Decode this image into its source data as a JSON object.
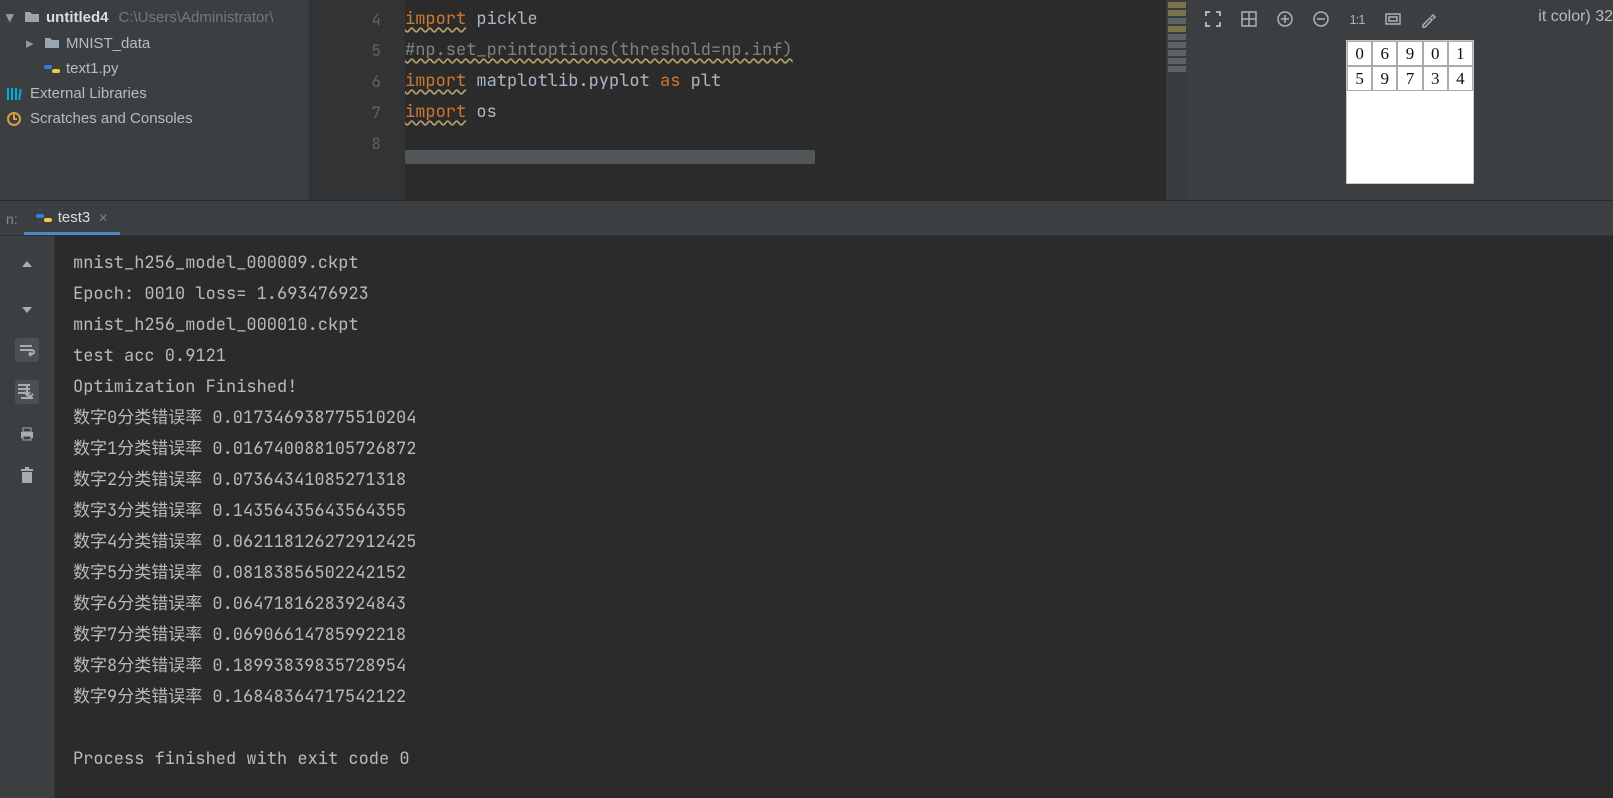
{
  "project_tree": {
    "root": {
      "label": "untitled4",
      "path": "C:\\Users\\Administrator\\"
    },
    "items": [
      {
        "label": "MNIST_data",
        "type": "folder"
      },
      {
        "label": "text1.py",
        "type": "pyfile"
      }
    ],
    "external_label": "External Libraries",
    "scratch_label": "Scratches and Consoles"
  },
  "editor": {
    "gutter_start": 4,
    "lines": [
      {
        "n": 4,
        "html": "<span class='kw wavy-y'>import</span> pickle"
      },
      {
        "n": 5,
        "html": "<span class='comment wavy-y'>#np.set_printoptions(threshold=np.inf)</span>"
      },
      {
        "n": 6,
        "html": "<span class='kw wavy-y'>import</span> matplotlib.pyplot <span class='op'>as</span> plt"
      },
      {
        "n": 7,
        "html": "<span class='kw wavy-y'>import</span> os"
      },
      {
        "n": 8,
        "html": ""
      }
    ]
  },
  "right_panel": {
    "bitcolor_text": "it color) 32",
    "ratio_label": "1:1",
    "digits": [
      [
        "0",
        "6",
        "9",
        "0",
        "1"
      ],
      [
        "5",
        "9",
        "7",
        "3",
        "4"
      ]
    ]
  },
  "run": {
    "label_left": "n:",
    "tab_label": "test3"
  },
  "console": {
    "lines": [
      "mnist_h256_model_000009.ckpt",
      "Epoch: 0010 loss= 1.693476923",
      "mnist_h256_model_000010.ckpt",
      "test acc 0.9121",
      "Optimization Finished!",
      "数字0分类错误率 0.017346938775510204",
      "数字1分类错误率 0.016740088105726872",
      "数字2分类错误率 0.07364341085271318",
      "数字3分类错误率 0.14356435643564355",
      "数字4分类错误率 0.062118126272912425",
      "数字5分类错误率 0.08183856502242152",
      "数字6分类错误率 0.06471816283924843",
      "数字7分类错误率 0.06906614785992218",
      "数字8分类错误率 0.18993839835728954",
      "数字9分类错误率 0.16848364717542122",
      "",
      "Process finished with exit code 0"
    ]
  }
}
